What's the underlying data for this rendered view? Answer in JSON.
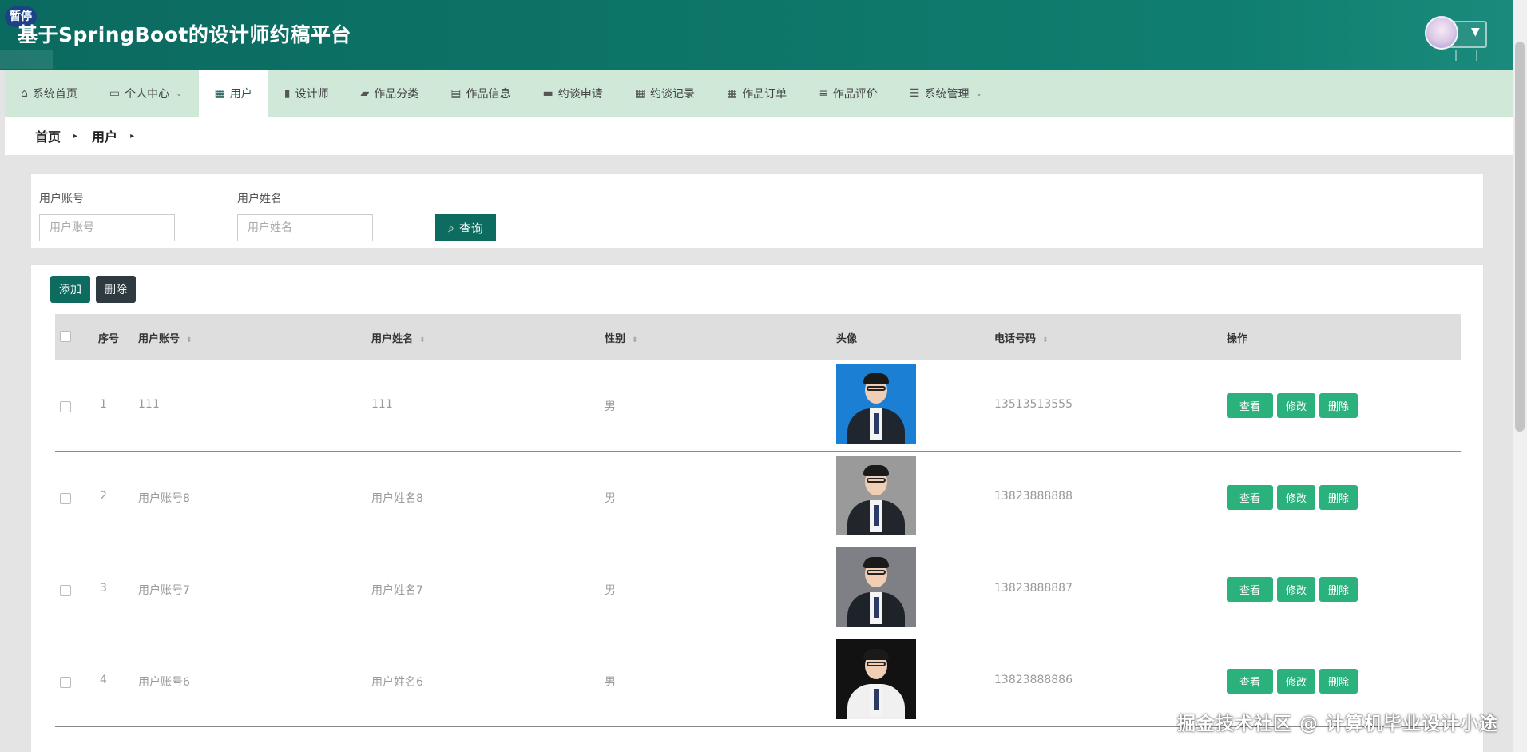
{
  "header": {
    "brand": "基于SpringBoot的设计师约稿平台",
    "pause_badge": "暂停",
    "user_caret": "▼"
  },
  "nav": {
    "items": [
      {
        "label": "系统首页",
        "icon": "⌂",
        "has_caret": false,
        "active": false
      },
      {
        "label": "个人中心",
        "icon": "▭",
        "has_caret": true,
        "active": false
      },
      {
        "label": "用户",
        "icon": "▦",
        "has_caret": false,
        "active": true
      },
      {
        "label": "设计师",
        "icon": "▮",
        "has_caret": false,
        "active": false
      },
      {
        "label": "作品分类",
        "icon": "▰",
        "has_caret": false,
        "active": false
      },
      {
        "label": "作品信息",
        "icon": "▤",
        "has_caret": false,
        "active": false
      },
      {
        "label": "约谈申请",
        "icon": "▬",
        "has_caret": false,
        "active": false
      },
      {
        "label": "约谈记录",
        "icon": "▦",
        "has_caret": false,
        "active": false
      },
      {
        "label": "作品订单",
        "icon": "▦",
        "has_caret": false,
        "active": false
      },
      {
        "label": "作品评价",
        "icon": "≡",
        "has_caret": false,
        "active": false
      },
      {
        "label": "系统管理",
        "icon": "☰",
        "has_caret": true,
        "active": false
      }
    ],
    "caret_glyph": "⌄"
  },
  "breadcrumb": {
    "home": "首页",
    "current": "用户",
    "sep": "▸"
  },
  "search": {
    "account_label": "用户账号",
    "account_placeholder": "用户账号",
    "name_label": "用户姓名",
    "name_placeholder": "用户姓名",
    "query_label": "查询",
    "query_icon": "⌕"
  },
  "toolbar": {
    "add_label": "添加",
    "delete_label": "删除"
  },
  "table": {
    "headers": {
      "index": "序号",
      "account": "用户账号",
      "name": "用户姓名",
      "gender": "性别",
      "avatar": "头像",
      "phone": "电话号码",
      "actions": "操作"
    },
    "sort_glyph": "⬍",
    "rows": [
      {
        "index": "1",
        "account": "111",
        "name": "111",
        "gender": "男",
        "phone": "13513513555",
        "photo_bg": "#1b7fd4",
        "suit": "#1f2630"
      },
      {
        "index": "2",
        "account": "用户账号8",
        "name": "用户姓名8",
        "gender": "男",
        "phone": "13823888888",
        "photo_bg": "#9a9a9a",
        "suit": "#22262c"
      },
      {
        "index": "3",
        "account": "用户账号7",
        "name": "用户姓名7",
        "gender": "男",
        "phone": "13823888887",
        "photo_bg": "#7e8085",
        "suit": "#1e2329"
      },
      {
        "index": "4",
        "account": "用户账号6",
        "name": "用户姓名6",
        "gender": "男",
        "phone": "13823888886",
        "photo_bg": "#121212",
        "suit": "#f0f0f0"
      }
    ],
    "row_actions": {
      "view": "查看",
      "edit": "修改",
      "delete": "删除"
    }
  },
  "watermark": "掘金技术社区 @ 计算机毕业设计小途",
  "colors": {
    "primary": "#0d6b5f",
    "nav_bg": "#cfe8d8",
    "action_green": "#2bb17c"
  }
}
